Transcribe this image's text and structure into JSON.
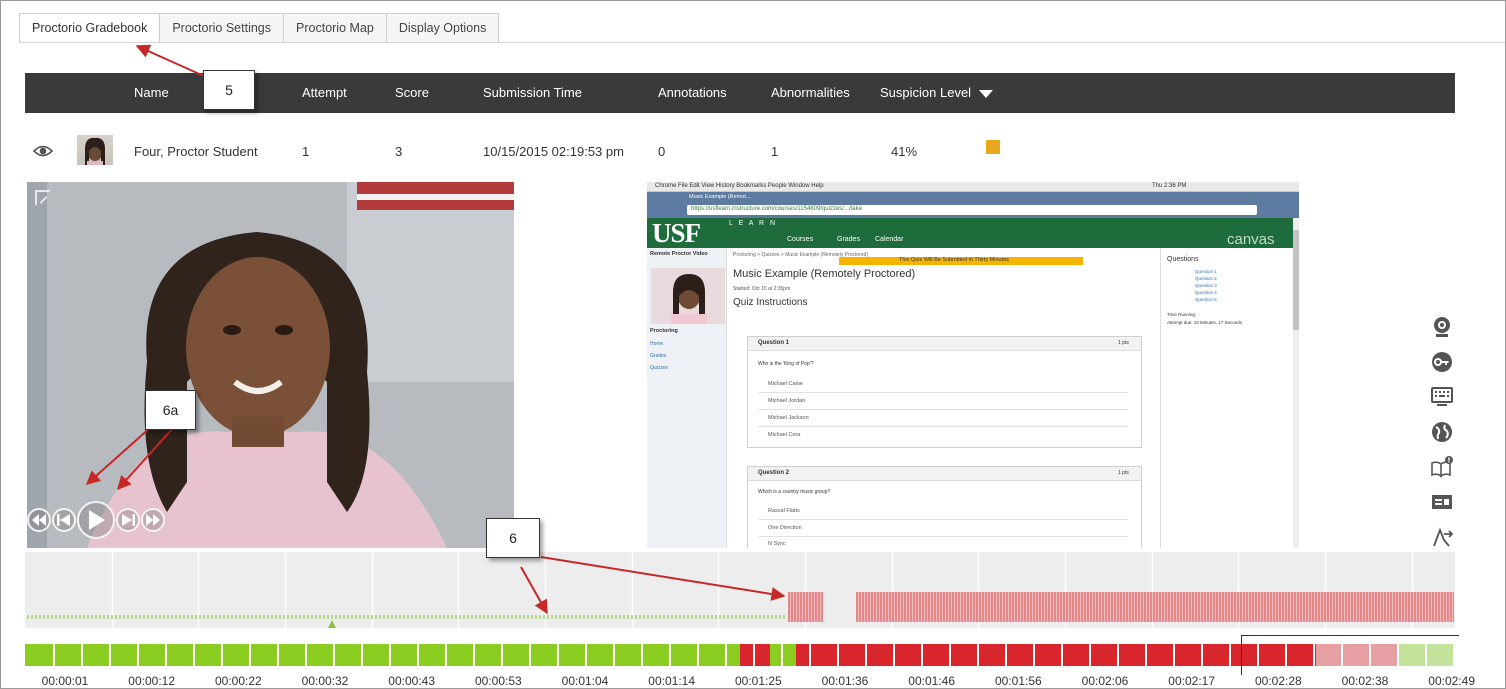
{
  "tabs": [
    {
      "label": "Proctorio Gradebook",
      "active": true
    },
    {
      "label": "Proctorio Settings",
      "active": false
    },
    {
      "label": "Proctorio Map",
      "active": false
    },
    {
      "label": "Display Options",
      "active": false
    }
  ],
  "table": {
    "headers": {
      "name": "Name",
      "attempt": "Attempt",
      "score": "Score",
      "submission_time": "Submission Time",
      "annotations": "Annotations",
      "abnormalities": "Abnormalities",
      "suspicion_level": "Suspicion Level"
    },
    "row": {
      "name": "Four, Proctor Student",
      "attempt": "1",
      "score": "3",
      "submission_time": "10/15/2015 02:19:53 pm",
      "annotations": "0",
      "abnormalities": "1",
      "suspicion_level": "41%",
      "suspicion_color": "#e8a81e"
    }
  },
  "screen_capture": {
    "mac_menu": "Chrome  File  Edit  View  History  Bookmarks  People  Window  Help",
    "clock": "Thu 2:36 PM",
    "chrome_tab": "Music Example (Remot...",
    "url": "https://usflearn.instructure.com/courses/1154809/quizzes/.../take",
    "logo": "USF",
    "logo_sub": "L E A R N",
    "nav": [
      "Courses",
      "Grades",
      "Calendar"
    ],
    "brand": "canvas",
    "banner": "This Quiz Will Be Submitted in Thirty Minutes",
    "breadcrumb": "Proctoring > Quizzes > Music Example (Remotely Proctored)",
    "quiz_title": "Music Example (Remotely Proctored)",
    "started": "Started: Oct 15 at 2:35pm",
    "instructions": "Quiz Instructions",
    "side_title": "Remote Proctor Video",
    "side_nav": [
      "Proctoring",
      "Home",
      "Grades",
      "Quizzes"
    ],
    "questions_title": "Questions",
    "question_links": [
      "Question 1",
      "Question 2",
      "Question 3",
      "Question 4",
      "Question 5"
    ],
    "time_running": "Time Running:",
    "time_elapsed": "Attempt due: 10 Minutes, 17 Seconds",
    "q1": {
      "title": "Question 1",
      "pts": "1 pts",
      "prompt": "Who is the 'King of Pop'?",
      "options": [
        "Michael Caine",
        "Michael Jordan",
        "Michael Jackson",
        "Michael Cera"
      ]
    },
    "q2": {
      "title": "Question 2",
      "pts": "1 pts",
      "prompt": "Which is a country music group?",
      "options": [
        "Rascal Flatts",
        "One Direction",
        "N Sync"
      ]
    }
  },
  "right_icons": [
    "webcam-icon",
    "key-icon",
    "keyboard-icon",
    "globe-icon",
    "book-alert-icon",
    "id-card-icon",
    "exit-icon"
  ],
  "timeline_times": [
    "00:00:01",
    "00:00:12",
    "00:00:22",
    "00:00:32",
    "00:00:43",
    "00:00:53",
    "00:01:04",
    "00:01:14",
    "00:01:25",
    "00:01:36",
    "00:01:46",
    "00:01:56",
    "00:02:06",
    "00:02:17",
    "00:02:28",
    "00:02:38",
    "00:02:49"
  ],
  "status_colors": {
    "normal": "#8ccd22",
    "flagged": "#d8262c",
    "normal_dim": "#c4e39a",
    "flagged_dim": "#e6a0a2"
  },
  "status_segments": [
    [
      "normal",
      0,
      8.25
    ],
    [
      "flagged",
      8.25,
      8.6
    ],
    [
      "normal",
      8.6,
      8.9
    ],
    [
      "flagged",
      8.9,
      14.9
    ],
    [
      "flagged_dim",
      14.9,
      15.85
    ],
    [
      "normal_dim",
      15.85,
      17
    ]
  ],
  "callouts": {
    "c5": "5",
    "c6": "6",
    "c6a": "6a"
  }
}
